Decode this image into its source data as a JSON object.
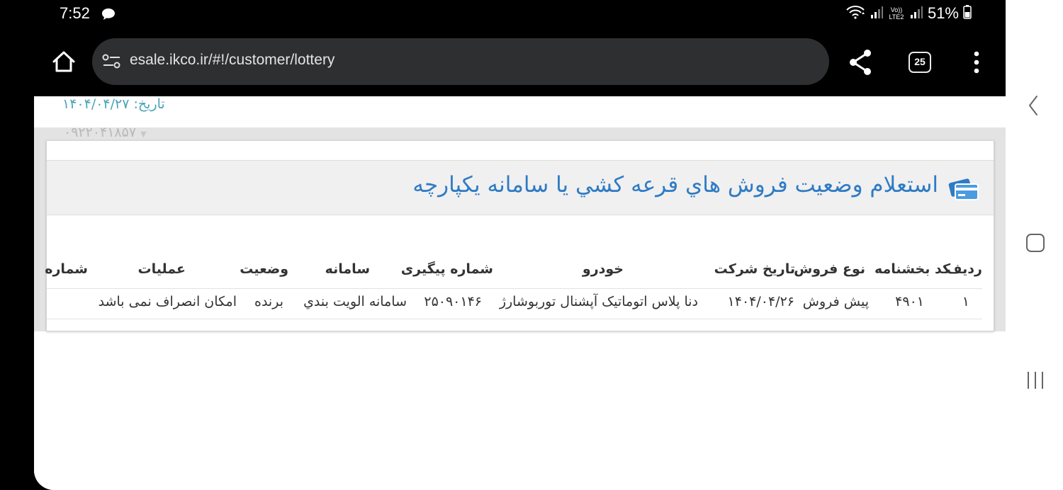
{
  "status_bar": {
    "time": "7:52",
    "network_label": "Vo)) LTE2",
    "battery": "51%"
  },
  "browser": {
    "url": "esale.ikco.ir/#!/customer/lottery",
    "tab_count": "25"
  },
  "page": {
    "date_label": "تاریخ: ۱۴۰۴/۰۴/۲۷",
    "phone_number": "۰۹۲۲۰۴۱۸۵۷",
    "panel_title": "استعلام وضعيت فروش هاي قرعه کشي يا سامانه يکپارچه"
  },
  "table": {
    "headers": {
      "row": "رديف",
      "circular_code": "کد بخشنامه",
      "sale_type": "نوع فروش",
      "company_date": "تاریخ شرکت",
      "vehicle": "خودرو",
      "tracking": "شماره پیگیری",
      "system": "سامانه",
      "status": "وضعيت",
      "operations": "عملیات",
      "number": "شماره"
    },
    "rows": [
      {
        "row": "۱",
        "circular_code": "۴۹۰۱",
        "sale_type": "پیش فروش",
        "company_date": "۱۴۰۴/۰۴/۲۶",
        "vehicle": "دنا پلاس اتوماتیک آپشنال توربوشارژ",
        "tracking": "۲۵۰۹۰۱۴۶",
        "system": "سامانه الويت بندي",
        "status": "برنده",
        "operations": "امکان انصراف نمی باشد"
      }
    ]
  },
  "colors": {
    "title_blue": "#2f7bc4",
    "date_teal": "#4aa3b8",
    "panel_header_bg": "#f0f0f0",
    "page_grey": "#e3e3e3"
  }
}
